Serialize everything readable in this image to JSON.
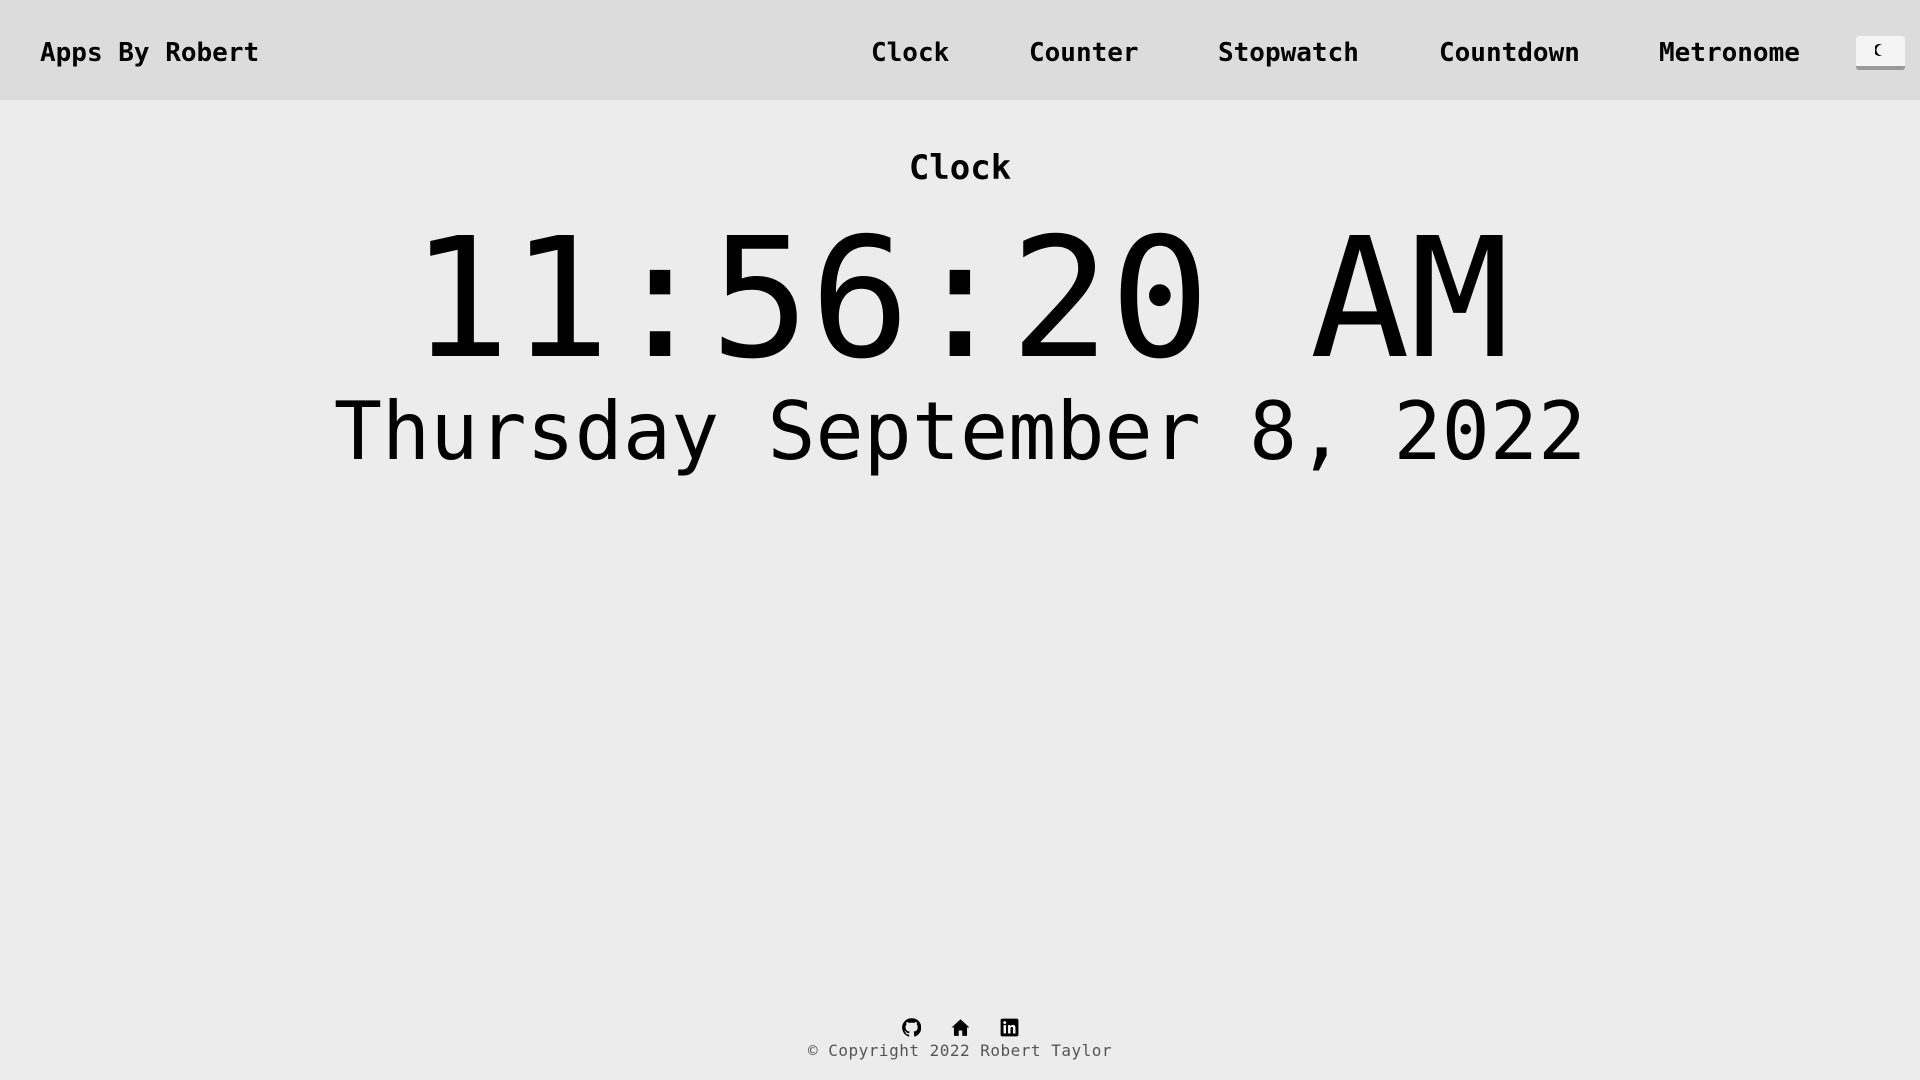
{
  "navbar": {
    "brand": "Apps By Robert",
    "links": [
      {
        "label": "Clock"
      },
      {
        "label": "Counter"
      },
      {
        "label": "Stopwatch"
      },
      {
        "label": "Countdown"
      },
      {
        "label": "Metronome"
      }
    ],
    "theme_toggle_icon": "moon-icon"
  },
  "main": {
    "title": "Clock",
    "time": "11:56:20 AM",
    "date": "Thursday September 8, 2022"
  },
  "footer": {
    "icons": [
      "github-icon",
      "home-icon",
      "linkedin-icon"
    ],
    "copyright": "© Copyright 2022 Robert Taylor"
  },
  "colors": {
    "navbar_bg": "#dcdcdc",
    "page_bg": "#ececec",
    "text": "#000000",
    "footer_text": "#555555"
  }
}
